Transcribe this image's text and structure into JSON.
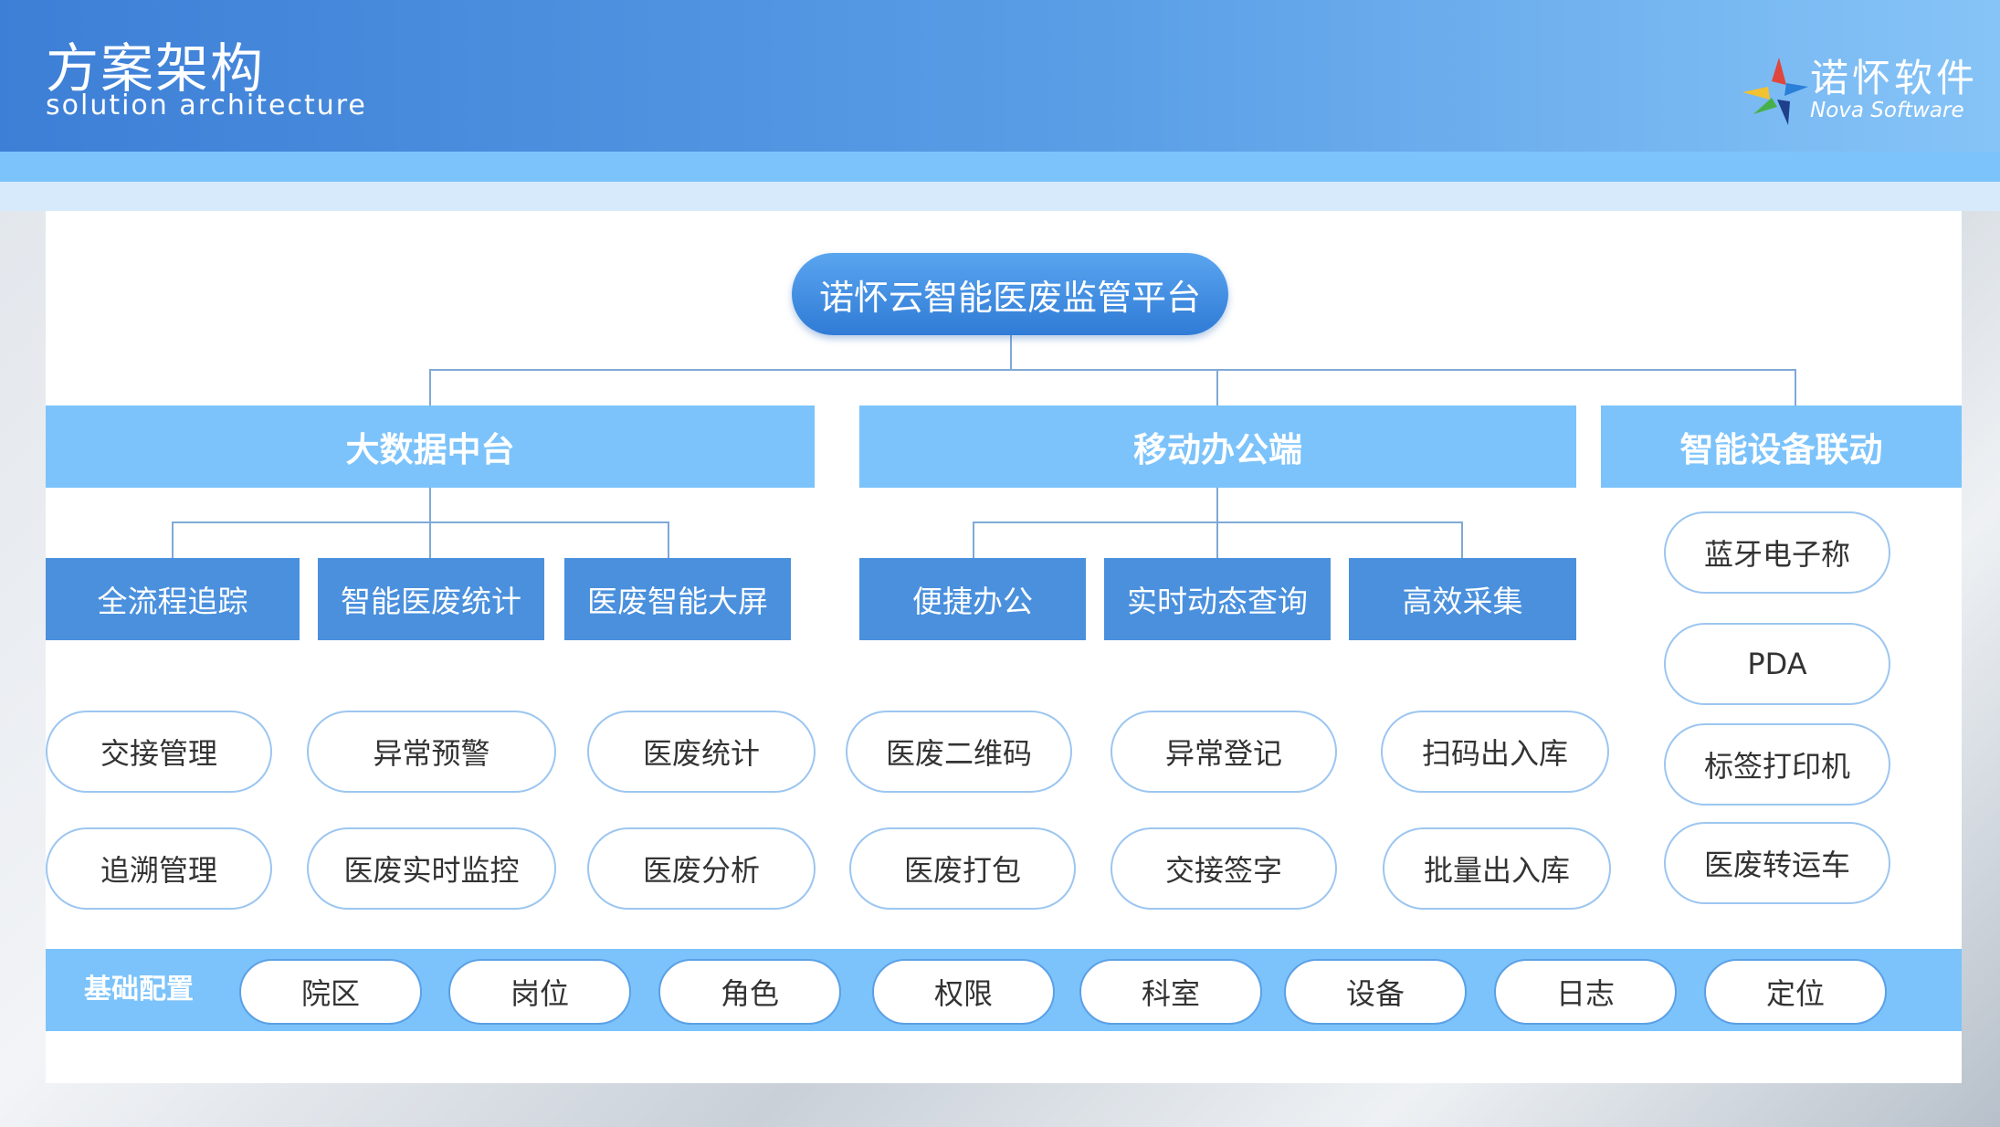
{
  "header": {
    "title_cn": "方案架构",
    "title_en": "solution architecture",
    "logo_cn": "诺怀软件",
    "logo_en": "Nova Software"
  },
  "root": "诺怀云智能医废监管平台",
  "branches": [
    {
      "label": "大数据中台",
      "subs": [
        "全流程追踪",
        "智能医废统计",
        "医废智能大屏"
      ],
      "items": [
        [
          "交接管理",
          "异常预警",
          "医废统计"
        ],
        [
          "追溯管理",
          "医废实时监控",
          "医废分析"
        ]
      ]
    },
    {
      "label": "移动办公端",
      "subs": [
        "便捷办公",
        "实时动态查询",
        "高效采集"
      ],
      "items": [
        [
          "医废二维码",
          "异常登记",
          "扫码出入库"
        ],
        [
          "医废打包",
          "交接签字",
          "批量出入库"
        ]
      ]
    },
    {
      "label": "智能设备联动",
      "items": [
        "蓝牙电子称",
        "PDA",
        "标签打印机",
        "医废转运车"
      ]
    }
  ],
  "base": {
    "label": "基础配置",
    "items": [
      "院区",
      "岗位",
      "角色",
      "权限",
      "科室",
      "设备",
      "日志",
      "定位"
    ]
  }
}
